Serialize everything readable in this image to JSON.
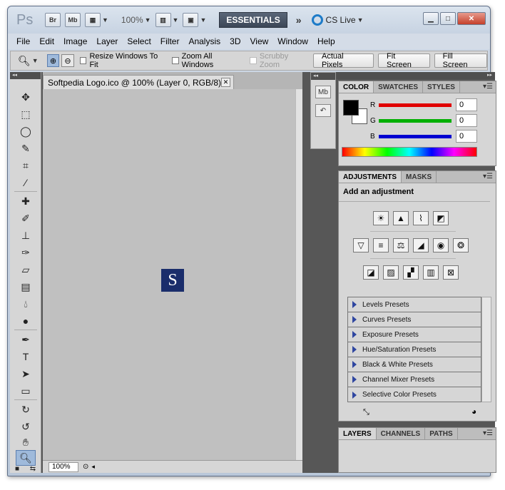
{
  "appbar": {
    "logo": "Ps",
    "br_label": "Br",
    "mb_label": "Mb",
    "zoom": "100%",
    "workspace": "ESSENTIALS",
    "cs_live": "CS Live"
  },
  "menu": [
    "File",
    "Edit",
    "Image",
    "Layer",
    "Select",
    "Filter",
    "Analysis",
    "3D",
    "View",
    "Window",
    "Help"
  ],
  "options": {
    "resize_windows": "Resize Windows To Fit",
    "zoom_all": "Zoom All Windows",
    "scrubby_zoom": "Scrubby Zoom",
    "actual_pixels": "Actual Pixels",
    "fit_screen": "Fit Screen",
    "fill_screen": "Fill Screen"
  },
  "document": {
    "tab_title": "Softpedia Logo.ico @ 100% (Layer 0, RGB/8)",
    "logo_letter": "S",
    "status_zoom": "100%"
  },
  "color_panel": {
    "tabs": [
      "COLOR",
      "SWATCHES",
      "STYLES"
    ],
    "r_label": "R",
    "g_label": "G",
    "b_label": "B",
    "r_value": "0",
    "g_value": "0",
    "b_value": "0",
    "r_color": "#e00000",
    "g_color": "#00b000",
    "b_color": "#0000d0"
  },
  "adjustments_panel": {
    "tabs": [
      "ADJUSTMENTS",
      "MASKS"
    ],
    "title": "Add an adjustment",
    "presets": [
      "Levels Presets",
      "Curves Presets",
      "Exposure Presets",
      "Hue/Saturation Presets",
      "Black & White Presets",
      "Channel Mixer Presets",
      "Selective Color Presets"
    ]
  },
  "layers_panel": {
    "tabs": [
      "LAYERS",
      "CHANNELS",
      "PATHS"
    ]
  }
}
